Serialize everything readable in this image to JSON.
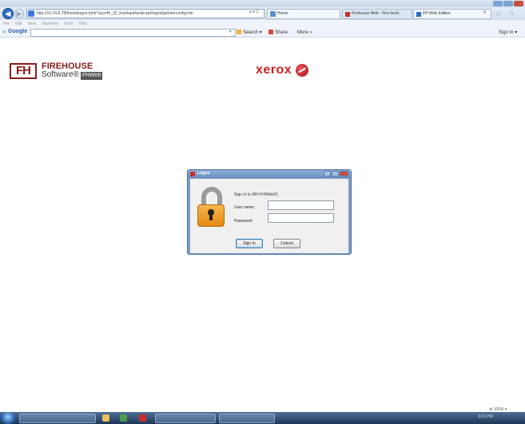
{
  "browser": {
    "address": "http://10.24.8.78/frweb/logon.html?acp=fh_32_frwebauthenticate/logon&printerconfig=de",
    "search_controls": "ρ ▾ C",
    "tabs": {
      "home": "Home",
      "tab1": "Firehouse Web - Fire Incid...",
      "tab2": "FH Web Edition"
    },
    "menu": [
      "File",
      "Edit",
      "View",
      "Favorites",
      "Tools",
      "Help"
    ]
  },
  "google_toolbar": {
    "logo": "Google",
    "search_label": "Search ▾",
    "share_label": "Share",
    "more_label": "More »",
    "signin_label": "Sign In ▾"
  },
  "page": {
    "fh_box": "FH",
    "fh_title": "FIREHOUSE",
    "fh_subtitle": "Software®",
    "fh_web": "FHWeb",
    "xerox": "xerox"
  },
  "dialog": {
    "title": "Logon",
    "heading": "Sign in to WH-FHWeb01",
    "user_label": "User name:",
    "user_value": "",
    "pass_label": "Password:",
    "pass_value": "",
    "signin_button": "Sign In",
    "cancel_button": "Cancel"
  },
  "status": {
    "zoom": "⊕ 100% ▾"
  },
  "taskbar": {
    "items": [
      "",
      "",
      "",
      "",
      ""
    ],
    "clock": "3:10 PM"
  },
  "colors": {
    "accent": "#1d57a8",
    "brand_fh": "#8a1c1c",
    "brand_xerox": "#d21f26",
    "lock": "#e58a12"
  }
}
